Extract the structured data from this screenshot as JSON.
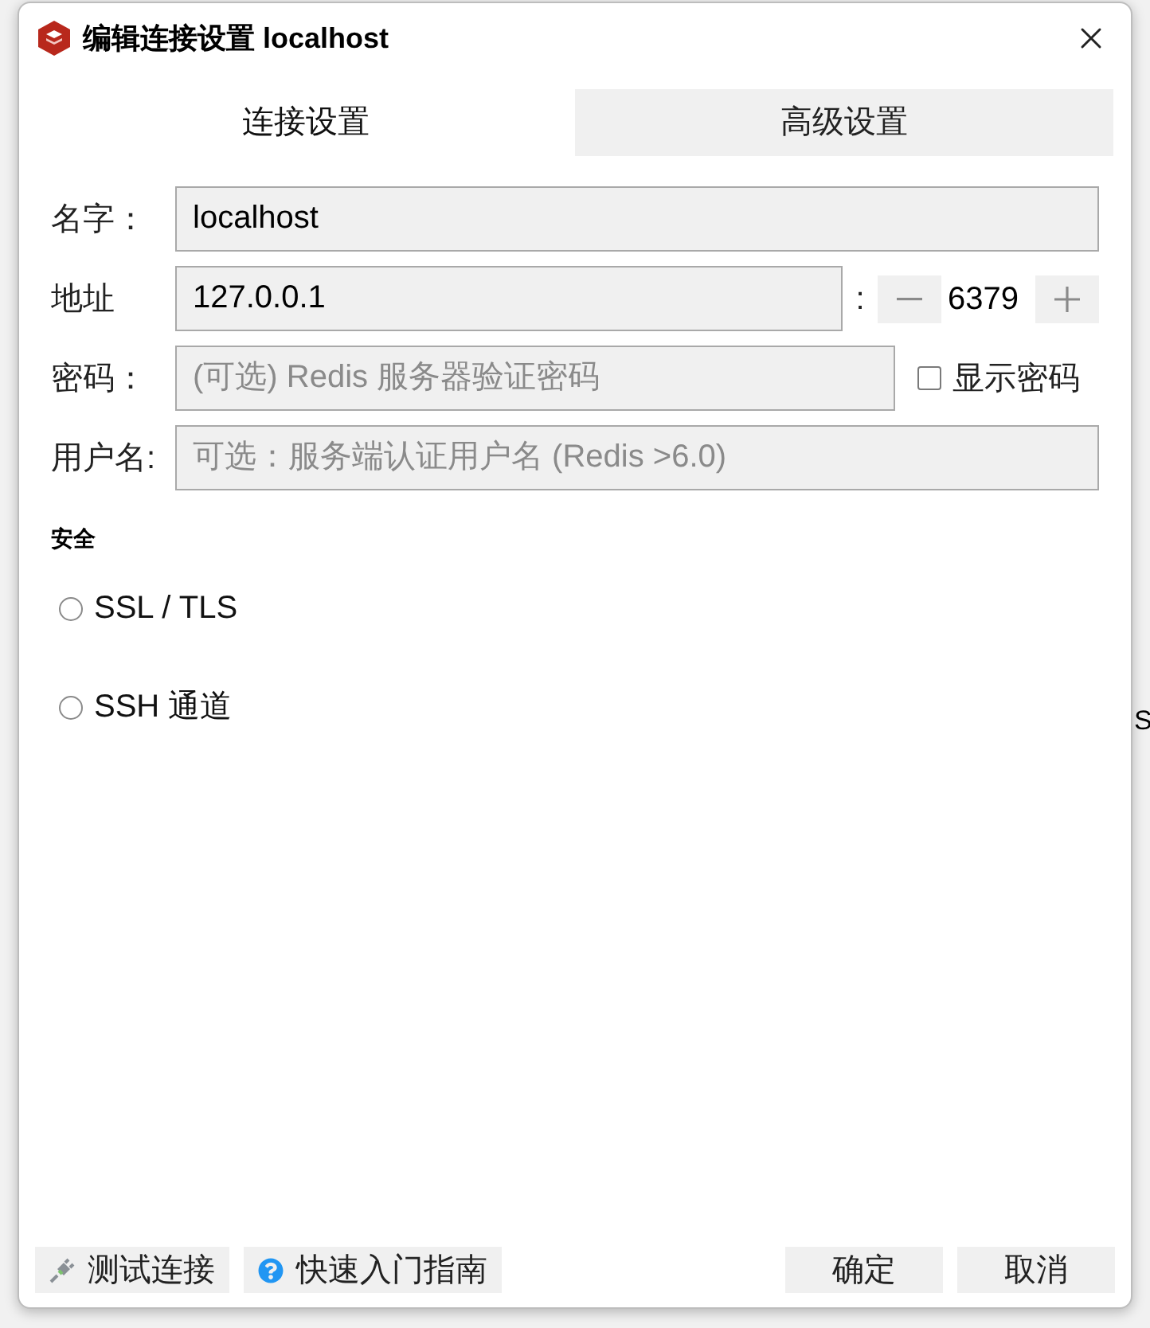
{
  "window": {
    "title": "编辑连接设置 localhost"
  },
  "tabs": [
    {
      "label": "连接设置",
      "selected": true
    },
    {
      "label": "高级设置",
      "selected": false
    }
  ],
  "form": {
    "name": {
      "label": "名字：",
      "value": "localhost"
    },
    "address": {
      "label": "地址",
      "value": "127.0.0.1",
      "separator": ":",
      "port": "6379"
    },
    "password": {
      "label": "密码：",
      "placeholder": "(可选) Redis 服务器验证密码",
      "show_password": {
        "label": "显示密码",
        "checked": false
      }
    },
    "username": {
      "label": "用户名:",
      "placeholder": "可选：服务端认证用户名 (Redis >6.0)"
    }
  },
  "security": {
    "heading": "安全",
    "options": [
      {
        "label": "SSL / TLS",
        "selected": false
      },
      {
        "label": "SSH 通道",
        "selected": false
      }
    ]
  },
  "footer": {
    "left_buttons": [
      {
        "label": "测试连接",
        "kind": "test"
      },
      {
        "label": "快速入门指南",
        "kind": "help"
      }
    ],
    "right_buttons": [
      {
        "label": "确定"
      },
      {
        "label": "取消"
      }
    ]
  },
  "background_text": "S"
}
